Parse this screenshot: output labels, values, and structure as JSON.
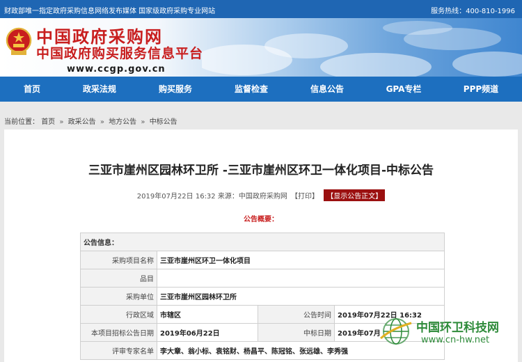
{
  "topbar": {
    "left_text": "财政部唯一指定政府采购信息网络发布媒体 国家级政府采购专业网站",
    "right_text": "服务热线：400-810-1996"
  },
  "banner": {
    "title": "中国政府采购网",
    "subtitle": "中国政府购买服务信息平台",
    "url": "www.ccgp.gov.cn"
  },
  "nav": {
    "items": [
      "首页",
      "政采法规",
      "购买服务",
      "监督检查",
      "信息公告",
      "GPA专栏",
      "PPP频道"
    ]
  },
  "breadcrumb": {
    "label": "当前位置：",
    "items": [
      "首页",
      "政采公告",
      "地方公告",
      "中标公告"
    ],
    "separator": "»"
  },
  "announcement": {
    "title": "三亚市崖州区园林环卫所 -三亚市崖州区环卫一体化项目-中标公告",
    "meta": "2019年07月22日 16:32 来源：中国政府采购网",
    "print_label": "【打印】",
    "show_text_label": "【显示公告正文】",
    "overview_label": "公告概要："
  },
  "info_table": {
    "header": "公告信息：",
    "rows": [
      {
        "label": "采购项目名称",
        "value": "三亚市崖州区环卫一体化项目"
      },
      {
        "label": "品目",
        "value": ""
      },
      {
        "label": "采购单位",
        "value": "三亚市崖州区园林环卫所"
      },
      {
        "label": "行政区域",
        "value": "市辖区",
        "label2": "公告时间",
        "value2": "2019年07月22日 16:32"
      },
      {
        "label": "本项目招标公告日期",
        "value": "2019年06月22日",
        "label2": "中标日期",
        "value2": "2019年07月"
      },
      {
        "label": "评审专家名单",
        "value": "李大章、翁小标、袁铭财、杨昌平、陈冠铭、张远雄、李秀强"
      }
    ]
  },
  "watermark": {
    "name": "中国环卫科技网",
    "url": "www.cn-hw.net"
  },
  "colors": {
    "top_blue": "#1f66b3",
    "nav_blue": "#1d6fbf",
    "brand_red": "#c81e1e",
    "button_red": "#9b1010",
    "watermark_green": "#2e8b3a"
  }
}
